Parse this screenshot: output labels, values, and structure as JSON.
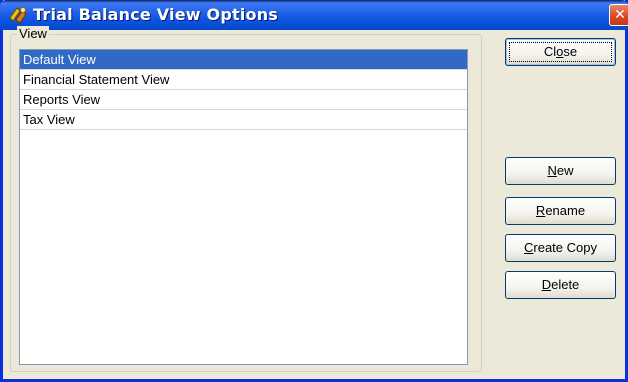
{
  "window": {
    "title": "Trial Balance View Options",
    "close_glyph": "✕",
    "app_icon": "trial-balance-app-icon"
  },
  "view_group": {
    "label": "View",
    "items": [
      {
        "label": "Default View",
        "selected": true
      },
      {
        "label": "Financial Statement View",
        "selected": false
      },
      {
        "label": "Reports View",
        "selected": false
      },
      {
        "label": "Tax View",
        "selected": false
      }
    ]
  },
  "buttons": {
    "close": {
      "pre": "Cl",
      "mnemonic": "o",
      "post": "se"
    },
    "new": {
      "pre": "",
      "mnemonic": "N",
      "post": "ew"
    },
    "rename": {
      "pre": "",
      "mnemonic": "R",
      "post": "ename"
    },
    "create_copy": {
      "pre": "",
      "mnemonic": "C",
      "post": "reate Copy"
    },
    "delete": {
      "pre": "",
      "mnemonic": "D",
      "post": "elete"
    }
  },
  "colors": {
    "titlebar": "#2461e8",
    "selection": "#316ac5",
    "dialog_bg": "#ece9d8",
    "close_button": "#d8451f"
  }
}
